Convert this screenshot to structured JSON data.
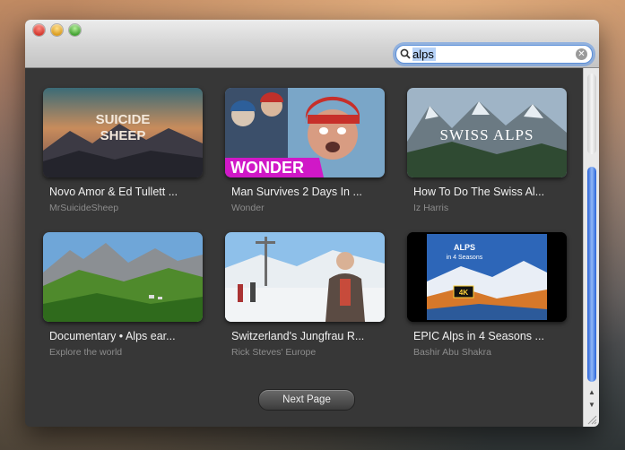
{
  "search": {
    "value": "alps"
  },
  "videos": [
    {
      "title": "Novo Amor & Ed Tullett ...",
      "channel": "MrSuicideSheep",
      "overlay": "SUICIDE SHEEP"
    },
    {
      "title": "Man Survives 2 Days In ...",
      "channel": "Wonder",
      "overlay": "WONDER"
    },
    {
      "title": "How To Do The Swiss Al...",
      "channel": "Iz Harris",
      "overlay": "SWISS ALPS"
    },
    {
      "title": "Documentary • Alps ear...",
      "channel": "Explore the world",
      "overlay": ""
    },
    {
      "title": "Switzerland's Jungfrau R...",
      "channel": "Rick Steves' Europe",
      "overlay": ""
    },
    {
      "title": "EPIC Alps in 4 Seasons ...",
      "channel": "Bashir Abu Shakra",
      "overlay": "ALPS in 4 Seasons",
      "badge": "4K UHD"
    }
  ],
  "pagination": {
    "next_label": "Next Page"
  }
}
